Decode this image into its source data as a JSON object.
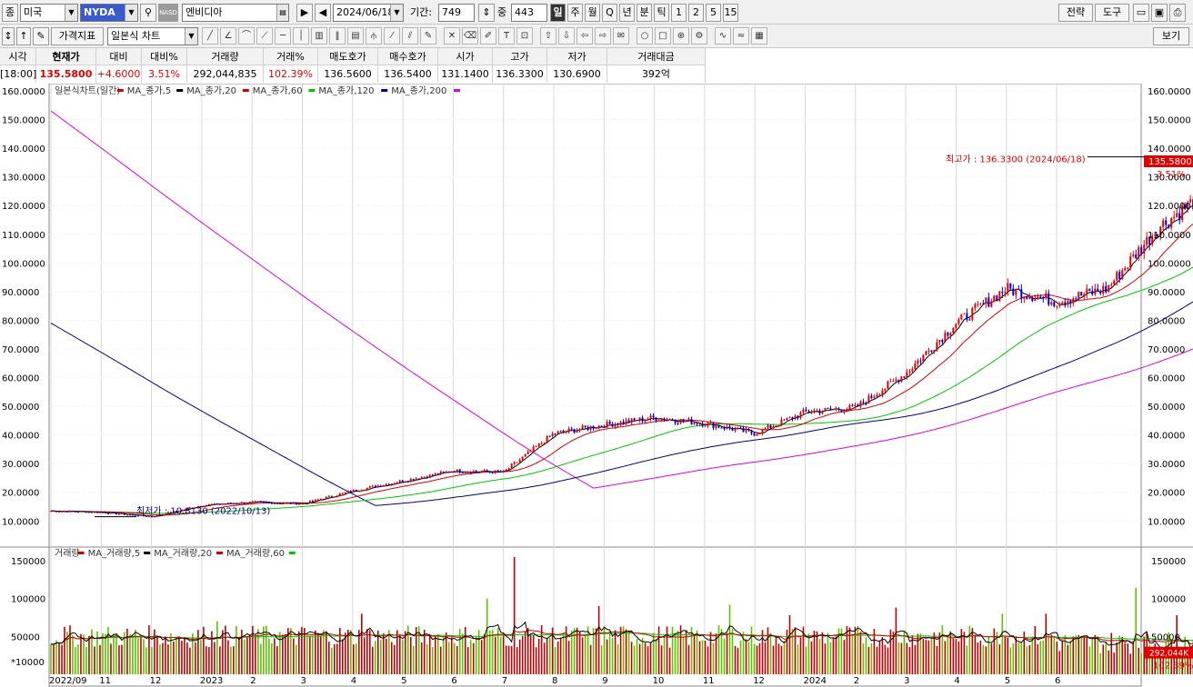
{
  "toolbar1": {
    "mode_button": "종",
    "market": "미국",
    "exchange": "NYDA",
    "nasd_badge": "NASD",
    "stock_name": "엔비디아",
    "date": "2024/06/18",
    "period_label": "기간:",
    "period_value": "749",
    "sub_label": "중",
    "sub_value": "443",
    "intervals": [
      "일",
      "주",
      "월",
      "Q",
      "년",
      "분",
      "틱",
      "1",
      "2",
      "5",
      "15"
    ],
    "right_buttons": [
      "전략",
      "도구"
    ]
  },
  "toolbar2": {
    "indicator_button": "가격지표",
    "chart_type": "일본식 차트",
    "view_button": "보기",
    "tool_icons": [
      "line-tool-icon",
      "angle-tool-icon",
      "arc-tool-icon",
      "fan-tool-icon",
      "hline-tool-icon",
      "vline-tool-icon",
      "grid-tool-icon",
      "cycle-tool-icon",
      "table-tool-icon",
      "fork-tool-icon",
      "trend-tool-icon",
      "channel-tool-icon",
      "pencil-tool-icon",
      "cross-tool-icon",
      "eraser-tool-icon",
      "note-tool-icon",
      "text-tool-icon",
      "box-tool-icon",
      "up-arrow-icon",
      "down-arrow-icon",
      "left-arrow-icon",
      "right-arrow-icon",
      "memo-icon",
      "circle-tool-icon",
      "rect-tool-icon",
      "zoom-tool-icon",
      "settings-tool-icon",
      "wave-tool-icon",
      "wave2-tool-icon",
      "image-tool-icon"
    ]
  },
  "quote": {
    "headers": [
      "시각",
      "현재가",
      "대비",
      "대비%",
      "거래량",
      "거래%",
      "매도호가",
      "매수호가",
      "시가",
      "고가",
      "저가",
      "거래대금"
    ],
    "values": [
      "[18:00]",
      "135.5800",
      "+4.6000",
      "3.51%",
      "292,044,835",
      "102.39%",
      "136.5600",
      "136.5400",
      "131.1400",
      "136.3300",
      "130.6900",
      "392억"
    ]
  },
  "colors": {
    "up": "#e10000",
    "down": "#0000d0",
    "ma5": "#000000",
    "ma20": "#d00000",
    "ma60": "#00c800",
    "ma120": "#000080",
    "ma200": "#e000e0",
    "vol_up": "#c00000",
    "vol_down": "#60c000"
  },
  "chart_data": [
    {
      "type": "candlestick",
      "legend": [
        "일본식차트(일간)",
        "MA_종가,5",
        "MA_종가,20",
        "MA_종가,60",
        "MA_종가,120",
        "MA_종가,200"
      ],
      "ylim": [
        0,
        160
      ],
      "y_ticks": [
        10,
        20,
        30,
        40,
        50,
        60,
        70,
        80,
        90,
        100,
        110,
        120,
        130,
        140,
        150,
        160
      ],
      "y_tick_labels": [
        "10.0000",
        "20.0000",
        "30.0000",
        "40.0000",
        "50.0000",
        "60.0000",
        "70.0000",
        "80.0000",
        "90.0000",
        "100.0000",
        "110.0000",
        "120.0000",
        "130.0000",
        "140.0000",
        "150.0000",
        "160.0000"
      ],
      "x_labels": [
        "2022/09",
        "11",
        "12",
        "2023",
        "2",
        "3",
        "4",
        "5",
        "6",
        "7",
        "8",
        "9",
        "10",
        "11",
        "12",
        "2024",
        "2",
        "3",
        "4",
        "5",
        "6"
      ],
      "close_path": {
        "months": [
          0,
          1,
          2,
          3,
          4,
          5,
          6,
          7,
          8,
          9,
          10,
          11,
          12,
          13,
          14,
          15,
          16,
          17,
          18,
          19,
          20,
          21,
          22,
          23,
          23.8
        ],
        "close": [
          13.5,
          13.0,
          11.5,
          15.5,
          16.5,
          16.0,
          20.5,
          24.0,
          27.5,
          27.0,
          40.5,
          43.5,
          46.0,
          44.0,
          40.5,
          48.0,
          49.5,
          61.5,
          79.0,
          91.0,
          86.5,
          91.0,
          112.0,
          125.0,
          135.58
        ]
      },
      "ma200_start": 153,
      "ma120_start": 79,
      "high_annotation": {
        "label": "최고가 : 136.3300 (2024/06/18)",
        "value": 136.33
      },
      "low_annotation": {
        "label": "최저가 : 10.8130 (2022/10/13)",
        "value": 10.813
      },
      "last_price_tag": "135.5800",
      "change_tag": "3.51%",
      "last_price": 135.58
    },
    {
      "type": "bar",
      "legend": [
        "거래량",
        "MA_거래량,5",
        "MA_거래량,20",
        "MA_거래량,60"
      ],
      "ylim": [
        0,
        160000
      ],
      "y_ticks": [
        50000,
        100000,
        150000
      ],
      "y_tick_labels": [
        "50000",
        "100000",
        "150000"
      ],
      "unit_label": "*10000",
      "last_volume_tag": "292,044K",
      "volume_ratio_tag": "102.39%",
      "last_volume": 29204,
      "spikes": [
        {
          "m": 9.2,
          "v": 155000
        },
        {
          "m": 8.7,
          "v": 100000
        },
        {
          "m": 10.9,
          "v": 90000
        },
        {
          "m": 13.5,
          "v": 92000
        },
        {
          "m": 16.8,
          "v": 88000
        },
        {
          "m": 21.6,
          "v": 114000
        },
        {
          "m": 14.7,
          "v": 78000
        },
        {
          "m": 6.2,
          "v": 80000
        },
        {
          "m": 3.3,
          "v": 70000
        },
        {
          "m": 18.9,
          "v": 80000
        },
        {
          "m": 19.8,
          "v": 80000
        },
        {
          "m": 22.4,
          "v": 78000
        }
      ]
    }
  ]
}
